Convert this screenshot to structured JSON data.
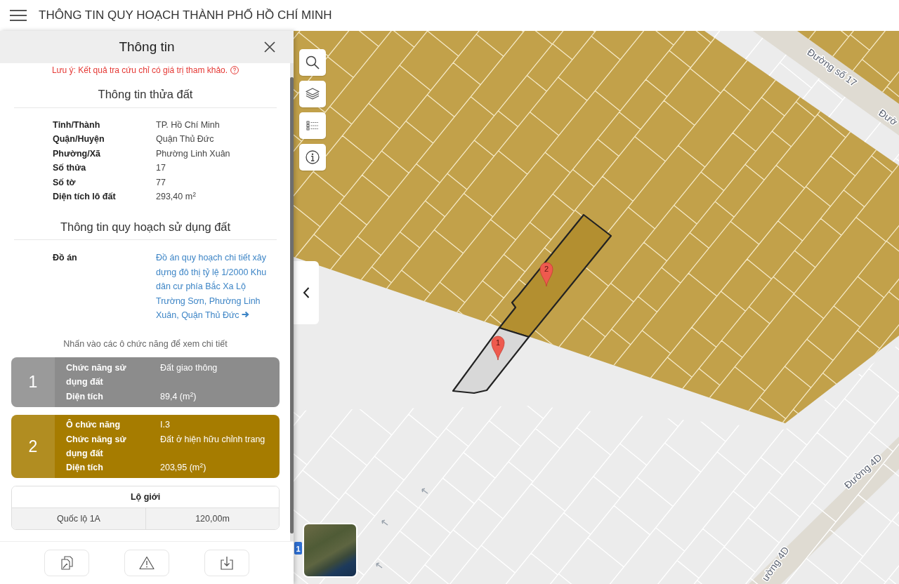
{
  "header": {
    "title": "THÔNG TIN QUY HOẠCH THÀNH PHỐ HỒ CHÍ MINH"
  },
  "panel": {
    "title": "Thông tin",
    "notice": "Lưu ý: Kết quả tra cứu chỉ có giá trị tham khảo.",
    "parcel_info": {
      "heading": "Thông tin thửa đất",
      "rows": [
        {
          "label": "Tỉnh/Thành",
          "value": "TP. Hồ Chí Minh"
        },
        {
          "label": "Quận/Huyện",
          "value": "Quận Thủ Đức"
        },
        {
          "label": "Phường/Xã",
          "value": "Phường Linh Xuân"
        },
        {
          "label": "Số thửa",
          "value": "17"
        },
        {
          "label": "Số tờ",
          "value": "77"
        },
        {
          "label": "Diện tích lô đất",
          "value": "293,40 m$^{2}$"
        }
      ]
    },
    "planning_info": {
      "heading": "Thông tin quy hoạch sử dụng đất",
      "rows": [
        {
          "label": "Đồ án",
          "value": "Đồ án quy hoạch chi tiết xây dựng đô thị tỷ lệ 1/2000 Khu dân cư phía Bắc Xa Lộ Trường Sơn, Phường Linh Xuân, Quận Thủ Đức",
          "kind": "link"
        }
      ]
    },
    "hint": "Nhấn vào các ô chức năng để xem chi tiết",
    "function_cards": [
      {
        "number": "1",
        "color": "#8c8c8c",
        "rows": [
          {
            "label": "Chức năng sử dụng đất",
            "value": "Đất giao thông"
          },
          {
            "label": "Diện tích",
            "value": "89,4 (m$^{2}$)"
          }
        ]
      },
      {
        "number": "2",
        "color": "#a67c00",
        "rows": [
          {
            "label": "Ô chức năng",
            "value": "I.3"
          },
          {
            "label": "Chức năng sử dụng đất",
            "value": "Đất ở hiện hữu chỉnh trang"
          },
          {
            "label": "Diện tích",
            "value": "203,95 (m$^{2}$)"
          }
        ]
      }
    ],
    "road_width": {
      "heading": "Lộ giới",
      "rows": [
        {
          "road": "Quốc lộ 1A",
          "width": "120,00m"
        }
      ]
    }
  },
  "map": {
    "road_labels": [
      "Đường số 17",
      "Đườ",
      "Đường 4D",
      "ường 4D"
    ],
    "markers": [
      "1",
      "2"
    ],
    "route_shield": "1"
  }
}
